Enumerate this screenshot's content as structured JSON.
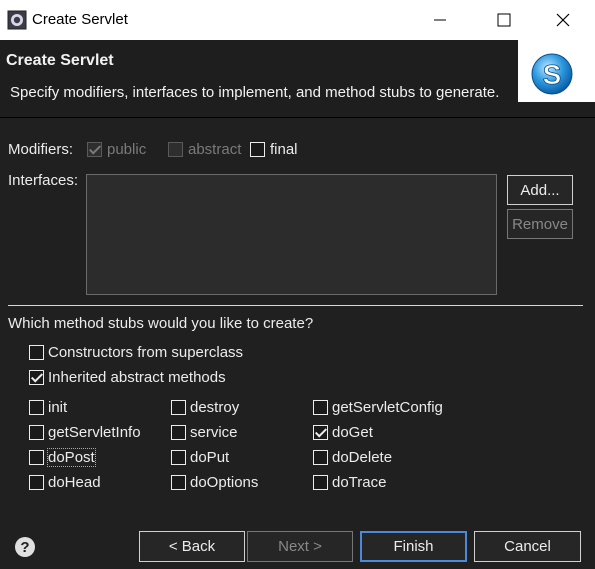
{
  "window": {
    "title": "Create Servlet",
    "icons": {
      "app": "eclipse-icon",
      "minimize": "minimize-icon",
      "maximize": "maximize-icon",
      "close": "close-icon"
    }
  },
  "banner": {
    "heading": "Create Servlet",
    "description": "Specify modifiers, interfaces to implement, and method stubs to generate.",
    "logo_icon": "servlet-logo-icon",
    "logo_letter": "S"
  },
  "modifiers": {
    "label": "Modifiers:",
    "public": {
      "label": "public",
      "checked": true,
      "enabled": false
    },
    "abstract": {
      "label": "abstract",
      "checked": false,
      "enabled": false
    },
    "final": {
      "label": "final",
      "checked": false,
      "enabled": true
    }
  },
  "interfaces": {
    "label": "Interfaces:",
    "items": [],
    "add_label": "Add...",
    "remove_label": "Remove"
  },
  "stubs": {
    "question": "Which method stubs would you like to create?",
    "constructors": {
      "label": "Constructors from superclass",
      "checked": false
    },
    "inherited": {
      "label": "Inherited abstract methods",
      "checked": true
    },
    "methods": [
      {
        "label": "init",
        "checked": false
      },
      {
        "label": "destroy",
        "checked": false
      },
      {
        "label": "getServletConfig",
        "checked": false
      },
      {
        "label": "getServletInfo",
        "checked": false
      },
      {
        "label": "service",
        "checked": false
      },
      {
        "label": "doGet",
        "checked": true
      },
      {
        "label": "doPost",
        "checked": false
      },
      {
        "label": "doPut",
        "checked": false
      },
      {
        "label": "doDelete",
        "checked": false
      },
      {
        "label": "doHead",
        "checked": false
      },
      {
        "label": "doOptions",
        "checked": false
      },
      {
        "label": "doTrace",
        "checked": false
      }
    ]
  },
  "footer": {
    "help_icon": "help-icon",
    "help_glyph": "?",
    "back_label": "< Back",
    "next_label": "Next >",
    "finish_label": "Finish",
    "cancel_label": "Cancel"
  },
  "colors": {
    "background": "#202020",
    "banner": "#1e1e1e",
    "text": "#ececec",
    "default_button_border": "#4a8ad8"
  }
}
